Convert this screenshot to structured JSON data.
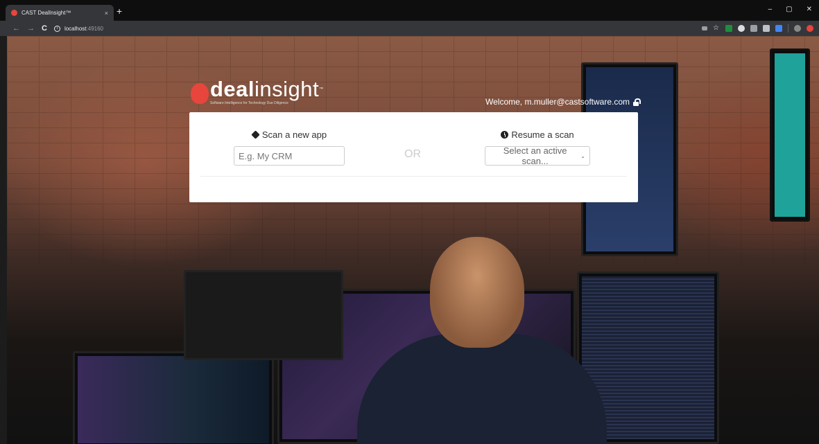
{
  "browser": {
    "tab_title": "CAST DealInsight™",
    "tab_close": "×",
    "new_tab": "+",
    "window_controls": [
      "–",
      "▢",
      "✕"
    ],
    "nav": {
      "back": "←",
      "forward": "→",
      "reload": "C"
    },
    "url_host": "localhost",
    "url_port": ":49160"
  },
  "brand": {
    "name_bold": "deal",
    "name_light": "insight",
    "trademark": "™",
    "tagline": "Software Intelligence for Technology Due Diligence"
  },
  "header": {
    "welcome_text": "Welcome, m.muller@castsoftware.com"
  },
  "scan_new": {
    "title": "Scan a new app",
    "placeholder": "E.g. My CRM",
    "icon": "cube-icon"
  },
  "separator": "OR",
  "resume": {
    "title": "Resume a scan",
    "select_value": "Select an active scan...",
    "icon": "clock-icon"
  },
  "colors": {
    "brand_red": "#e8453c",
    "card_bg": "#ffffff",
    "chrome_dark": "#35363a"
  }
}
